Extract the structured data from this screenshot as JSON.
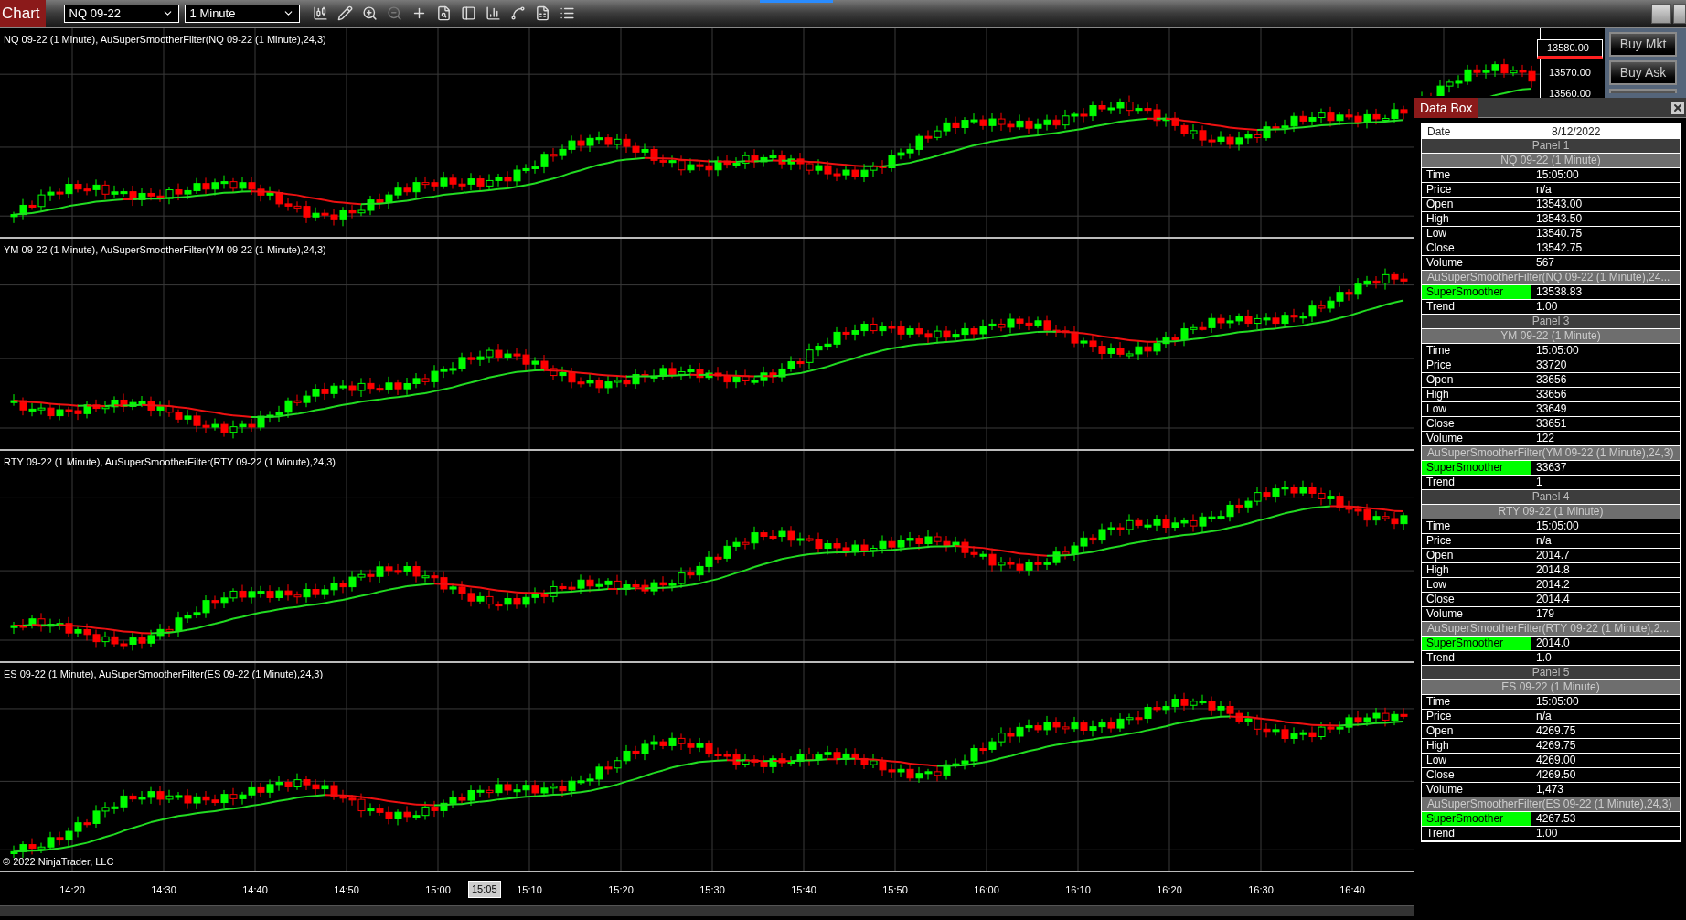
{
  "toolbar": {
    "tab": "Chart",
    "instrument": "NQ 09-22",
    "interval": "1 Minute"
  },
  "panels": [
    {
      "title": "NQ 09-22 (1 Minute), AuSuperSmootherFilter(NQ 09-22 (1 Minute),24,3)"
    },
    {
      "title": "YM 09-22 (1 Minute), AuSuperSmootherFilter(YM 09-22 (1 Minute),24,3)"
    },
    {
      "title": "RTY 09-22 (1 Minute), AuSuperSmootherFilter(RTY 09-22 (1 Minute),24,3)"
    },
    {
      "title": "ES 09-22 (1 Minute), AuSuperSmootherFilter(ES 09-22 (1 Minute),24,3)"
    }
  ],
  "price_axis": {
    "last_price": "13580.00",
    "labels": [
      "13570.00",
      "13560.00"
    ]
  },
  "order_buttons": [
    "Buy Mkt",
    "Buy Ask"
  ],
  "copyright": "© 2022 NinjaTrader, LLC",
  "time_axis": {
    "labels": [
      "14:20",
      "14:30",
      "14:40",
      "14:50",
      "15:00",
      "15:10",
      "15:20",
      "15:30",
      "15:40",
      "15:50",
      "16:00",
      "16:10",
      "16:20",
      "16:30",
      "16:40"
    ],
    "cursor": "15:05"
  },
  "data_box": {
    "title": "Data Box",
    "date_label": "Date",
    "date_value": "8/12/2022",
    "sections": [
      {
        "panel": "Panel 1",
        "series": "NQ 09-22 (1 Minute)",
        "rows": [
          {
            "label": "Time",
            "value": "15:05:00"
          },
          {
            "label": "Price",
            "value": "n/a"
          },
          {
            "label": "Open",
            "value": "13543.00"
          },
          {
            "label": "High",
            "value": "13543.50"
          },
          {
            "label": "Low",
            "value": "13540.75"
          },
          {
            "label": "Close",
            "value": "13542.75"
          },
          {
            "label": "Volume",
            "value": "567"
          }
        ],
        "indicator": "AuSuperSmootherFilter(NQ 09-22 (1 Minute),24...",
        "plots": [
          {
            "label": "SuperSmoother",
            "value": "13538.83",
            "color": "#00ff00"
          },
          {
            "label": "Trend",
            "value": "1.00"
          }
        ]
      },
      {
        "panel": "Panel 3",
        "series": "YM 09-22 (1 Minute)",
        "rows": [
          {
            "label": "Time",
            "value": "15:05:00"
          },
          {
            "label": "Price",
            "value": "33720"
          },
          {
            "label": "Open",
            "value": "33656"
          },
          {
            "label": "High",
            "value": "33656"
          },
          {
            "label": "Low",
            "value": "33649"
          },
          {
            "label": "Close",
            "value": "33651"
          },
          {
            "label": "Volume",
            "value": "122"
          }
        ],
        "indicator": "AuSuperSmootherFilter(YM 09-22 (1 Minute),24,3)",
        "plots": [
          {
            "label": "SuperSmoother",
            "value": "33637",
            "color": "#00ff00"
          },
          {
            "label": "Trend",
            "value": "1"
          }
        ]
      },
      {
        "panel": "Panel 4",
        "series": "RTY 09-22 (1 Minute)",
        "rows": [
          {
            "label": "Time",
            "value": "15:05:00"
          },
          {
            "label": "Price",
            "value": "n/a"
          },
          {
            "label": "Open",
            "value": "2014.7"
          },
          {
            "label": "High",
            "value": "2014.8"
          },
          {
            "label": "Low",
            "value": "2014.2"
          },
          {
            "label": "Close",
            "value": "2014.4"
          },
          {
            "label": "Volume",
            "value": "179"
          }
        ],
        "indicator": "AuSuperSmootherFilter(RTY 09-22 (1 Minute),2...",
        "plots": [
          {
            "label": "SuperSmoother",
            "value": "2014.0",
            "color": "#00ff00"
          },
          {
            "label": "Trend",
            "value": "1.0"
          }
        ]
      },
      {
        "panel": "Panel 5",
        "series": "ES 09-22 (1 Minute)",
        "rows": [
          {
            "label": "Time",
            "value": "15:05:00"
          },
          {
            "label": "Price",
            "value": "n/a"
          },
          {
            "label": "Open",
            "value": "4269.75"
          },
          {
            "label": "High",
            "value": "4269.75"
          },
          {
            "label": "Low",
            "value": "4269.00"
          },
          {
            "label": "Close",
            "value": "4269.50"
          },
          {
            "label": "Volume",
            "value": "1,473"
          }
        ],
        "indicator": "AuSuperSmootherFilter(ES 09-22 (1 Minute),24,3)",
        "plots": [
          {
            "label": "SuperSmoother",
            "value": "4267.53",
            "color": "#00ff00"
          },
          {
            "label": "Trend",
            "value": "1.00"
          }
        ]
      }
    ]
  }
}
